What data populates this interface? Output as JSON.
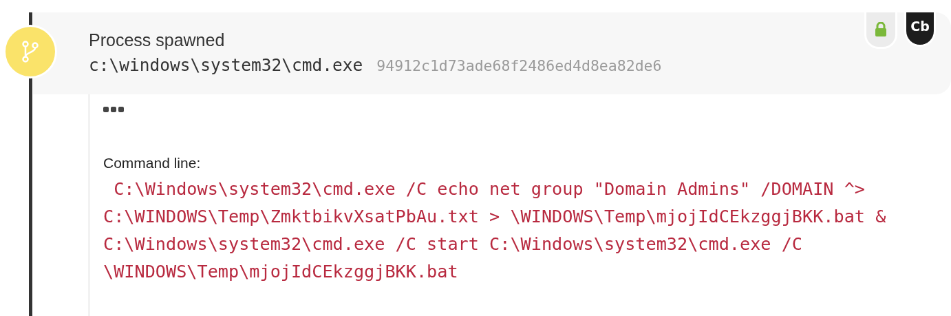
{
  "event": {
    "title": "Process spawned",
    "path": "c:\\windows\\system32\\cmd.exe",
    "hash": "94912c1d73ade68f2486ed4d8ea82de6",
    "locked": true,
    "badge": "Cb"
  },
  "details": {
    "label": "Command line:",
    "command_lines": [
      " C:\\Windows\\system32\\cmd.exe /C echo net group \"Domain Admins\" /DOMAIN ^>",
      "C:\\WINDOWS\\Temp\\ZmktbikvXsatPbAu.txt > \\WINDOWS\\Temp\\mjojIdCEkzggjBKK.bat &",
      "C:\\Windows\\system32\\cmd.exe /C start C:\\Windows\\system32\\cmd.exe /C",
      "\\WINDOWS\\Temp\\mjojIdCEkzggjBKK.bat"
    ]
  }
}
